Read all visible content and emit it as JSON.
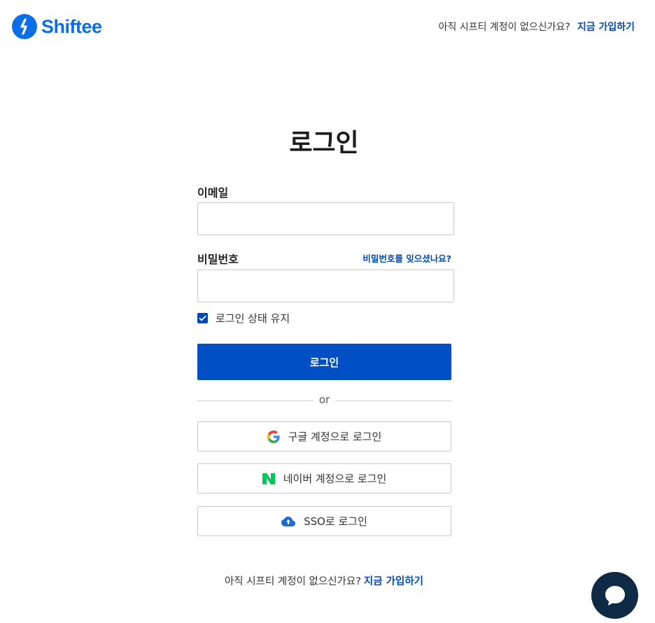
{
  "header": {
    "brand": "Shiftee",
    "signup_prompt": "아직 시프티 계정이 없으신가요?",
    "signup_link": "지금 가입하기"
  },
  "title": "로그인",
  "form": {
    "email_label": "이메일",
    "email_value": "",
    "password_label": "비밀번호",
    "password_value": "",
    "forgot_link": "비밀번호를 잊으셨나요?",
    "remember_label": "로그인 상태 유지",
    "remember_checked": true,
    "login_button": "로그인",
    "divider_text": "or"
  },
  "social": {
    "google": "구글 계정으로 로그인",
    "naver": "네이버 계정으로 로그인",
    "sso": "SSO로 로그인"
  },
  "footer": {
    "signup_prompt": "아직 시프티 계정이 없으신가요?",
    "signup_link": "지금 가입하기"
  },
  "colors": {
    "primary": "#004fc4",
    "brand": "#0a6ee8",
    "link": "#0049b8",
    "chat": "#0f2a44"
  },
  "icons": [
    "shiftee-logo-icon",
    "check-icon",
    "google-icon",
    "naver-icon",
    "cloud-upload-icon",
    "chat-bubble-icon"
  ]
}
